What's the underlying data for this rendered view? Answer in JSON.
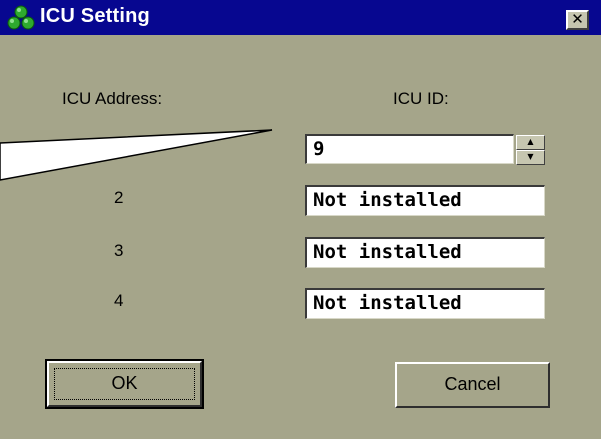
{
  "window": {
    "title": "ICU Setting",
    "close_symbol": "✕",
    "icon": "cluster-icon"
  },
  "labels": {
    "icu_address": "ICU Address:",
    "icu_id": "ICU ID:"
  },
  "rows": [
    {
      "address": "",
      "id_value": "9",
      "has_spinner": true
    },
    {
      "address": "2",
      "id_value": "Not installed"
    },
    {
      "address": "3",
      "id_value": "Not installed"
    },
    {
      "address": "4",
      "id_value": "Not installed"
    }
  ],
  "buttons": {
    "ok": "OK",
    "cancel": "Cancel"
  },
  "spinner": {
    "up": "▲",
    "down": "▼"
  },
  "colors": {
    "titlebar": "#070790",
    "dialog_bg": "#a5a58a",
    "icon_green": "#2eaa2e"
  }
}
